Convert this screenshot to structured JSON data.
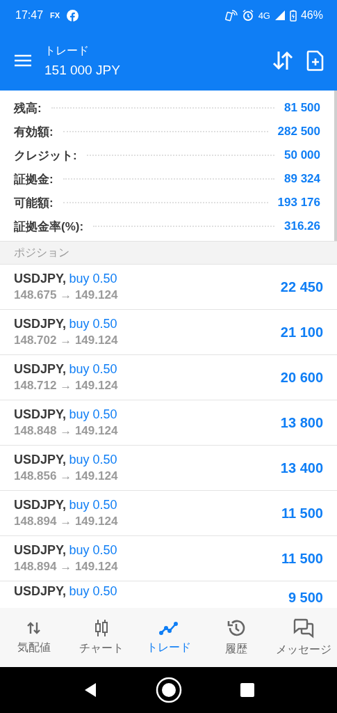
{
  "status_bar": {
    "time": "17:47",
    "app_badge": "FX",
    "network": "4G",
    "battery": "46%"
  },
  "toolbar": {
    "title": "トレード",
    "subtitle": "151 000 JPY"
  },
  "summary": [
    {
      "label": "残高:",
      "value": "81 500"
    },
    {
      "label": "有効額:",
      "value": "282 500"
    },
    {
      "label": "クレジット:",
      "value": "50 000"
    },
    {
      "label": "証拠金:",
      "value": "89 324"
    },
    {
      "label": "可能額:",
      "value": "193 176"
    },
    {
      "label": "証拠金率(%):",
      "value": "316.26"
    }
  ],
  "section_header": "ポジション",
  "positions": [
    {
      "symbol": "USDJPY,",
      "order": "buy 0.50",
      "prices": "148.675 → 149.124",
      "profit": "22 450"
    },
    {
      "symbol": "USDJPY,",
      "order": "buy 0.50",
      "prices": "148.702 → 149.124",
      "profit": "21 100"
    },
    {
      "symbol": "USDJPY,",
      "order": "buy 0.50",
      "prices": "148.712 → 149.124",
      "profit": "20 600"
    },
    {
      "symbol": "USDJPY,",
      "order": "buy 0.50",
      "prices": "148.848 → 149.124",
      "profit": "13 800"
    },
    {
      "symbol": "USDJPY,",
      "order": "buy 0.50",
      "prices": "148.856 → 149.124",
      "profit": "13 400"
    },
    {
      "symbol": "USDJPY,",
      "order": "buy 0.50",
      "prices": "148.894 → 149.124",
      "profit": "11 500"
    },
    {
      "symbol": "USDJPY,",
      "order": "buy 0.50",
      "prices": "148.894 → 149.124",
      "profit": "11 500"
    },
    {
      "symbol": "USDJPY,",
      "order": "buy 0.50",
      "profit": "9 500"
    }
  ],
  "bottom_nav": [
    {
      "label": "気配値",
      "kind": "quotes",
      "selected": false
    },
    {
      "label": "チャート",
      "kind": "chart",
      "selected": false
    },
    {
      "label": "トレード",
      "kind": "trade",
      "selected": true
    },
    {
      "label": "履歴",
      "kind": "history",
      "selected": false
    },
    {
      "label": "メッセージ",
      "kind": "messages",
      "selected": false
    }
  ]
}
